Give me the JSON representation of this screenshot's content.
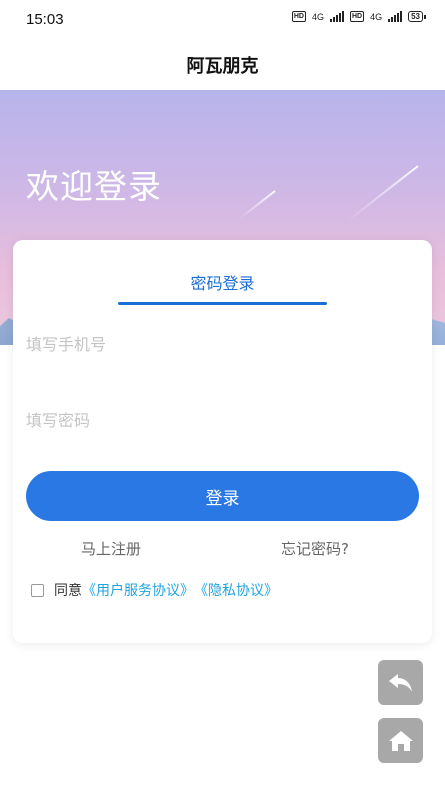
{
  "status_bar": {
    "time": "15:03",
    "hd1": "HD",
    "net1": "4G",
    "hd2": "HD",
    "net2": "4G",
    "battery": "53"
  },
  "app_bar": {
    "title": "阿瓦朋克"
  },
  "hero": {
    "title": "欢迎登录"
  },
  "login_card": {
    "tab_label": "密码登录",
    "phone_placeholder": "填写手机号",
    "password_placeholder": "填写密码",
    "login_button": "登录",
    "register_link": "马上注册",
    "forgot_link": "忘记密码?",
    "agreement": {
      "prefix": "同意",
      "user_agreement": "《用户服务协议》",
      "privacy_policy": "《隐私协议》"
    }
  },
  "floating_buttons": {
    "back_icon": "back-arrow-icon",
    "home_icon": "home-icon"
  },
  "colors": {
    "accent": "#2a78e4",
    "link": "#20a4e0",
    "float_button": "#a8a8a8"
  }
}
